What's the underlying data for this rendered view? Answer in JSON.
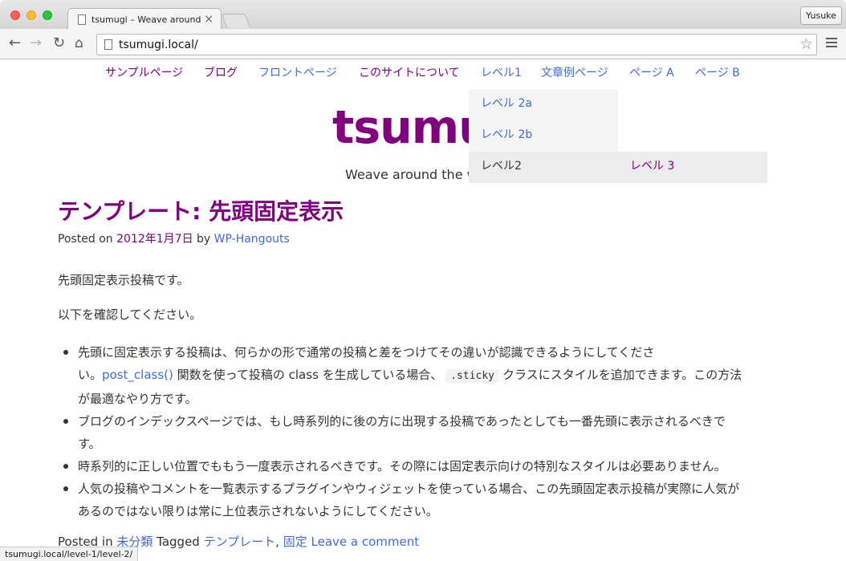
{
  "browser": {
    "tab_title": "tsumugi – Weave around th",
    "tab_close": "×",
    "profile_name": "Yusuke",
    "url": "tsumugi.local/",
    "status_url": "tsumugi.local/level-1/level-2/"
  },
  "site": {
    "nav": [
      {
        "label": "サンプルページ",
        "visited": true
      },
      {
        "label": "ブログ",
        "visited": true
      },
      {
        "label": "フロントページ",
        "visited": false
      },
      {
        "label": "このサイトについて",
        "visited": true
      },
      {
        "label": "レベル1",
        "visited": false
      },
      {
        "label": "文章例ページ",
        "visited": false
      },
      {
        "label": "ページ A",
        "visited": false
      },
      {
        "label": "ページ B",
        "visited": false
      }
    ],
    "dropdown": {
      "items": [
        "レベル 2a",
        "レベル 2b",
        "レベル2"
      ],
      "flyout_item": "レベル 3"
    },
    "title": "tsumugi",
    "tagline": "Weave around the w"
  },
  "post": {
    "title": "テンプレート: 先頭固定表示",
    "meta": {
      "posted_on": "Posted on",
      "date": "2012年1月7日",
      "by": "by",
      "author": "WP-Hangouts"
    },
    "paragraphs": [
      "先頭固定表示投稿です。",
      "以下を確認してください。"
    ],
    "bullets": {
      "b1_line1": "先頭に固定表示する投稿は、何らかの形で通常の投稿と差をつけてその違いが認識できるようにしてくださ",
      "b1_pre": "い。",
      "b1_link": "post_class()",
      "b1_mid": " 関数を使って投稿の class を生成している場合、",
      "b1_code": ".sticky",
      "b1_post": "クラスにスタイルを追加できます。この方法",
      "b1_line3": "が最適なやり方です。",
      "b2": "ブログのインデックスページでは、もし時系列的に後の方に出現する投稿であったとしても一番先頭に表示されるべきで",
      "b2_cont": "す。",
      "b3": "時系列的に正しい位置でももう一度表示されるべきです。その際には固定表示向けの特別なスタイルは必要ありません。",
      "b4": "人気の投稿やコメントを一覧表示するプラグインやウィジェットを使っている場合、この先頭固定表示投稿が実際に人気が",
      "b4_cont": "あるのではない限りは常に上位表示されないようにしてください。"
    },
    "footer": {
      "posted_in": "Posted in",
      "category": "未分類",
      "tagged": "Tagged",
      "tag1": "テンプレート",
      "sep": ",",
      "tag2": "固定",
      "comment": "Leave a comment"
    }
  },
  "icons": {
    "back": "arrow-left-icon",
    "forward": "arrow-right-icon",
    "reload": "reload-icon",
    "home": "home-icon",
    "bookmark": "star-icon",
    "menu": "hamburger-menu-icon",
    "page": "page-icon"
  },
  "colors": {
    "link": "#4169e1",
    "visited": "#800080",
    "text": "#333333"
  }
}
